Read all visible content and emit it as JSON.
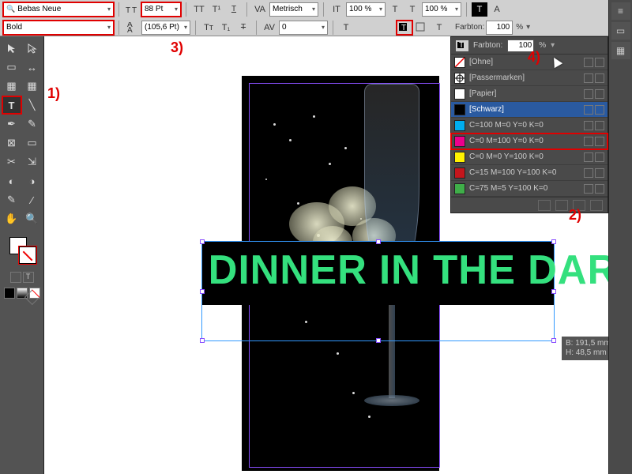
{
  "control_bar": {
    "font_family": "Bebas Neue",
    "font_style": "Bold",
    "font_size": "88 Pt",
    "leading": "(105,6 Pt)",
    "kerning_mode": "Metrisch",
    "hscale": "100 %",
    "vscale": "100 %",
    "tint_label": "Farbton:",
    "tint_value": "100",
    "tint_unit": "%"
  },
  "canvas": {
    "headline": "DINNER IN THE DARK",
    "info_w": "B: 191,5 mm",
    "info_h": "H: 48,5 mm"
  },
  "swatches": {
    "rows": [
      {
        "name": "[Ohne]",
        "color": "none",
        "sel": false
      },
      {
        "name": "[Passermarken]",
        "color": "registration",
        "sel": false
      },
      {
        "name": "[Papier]",
        "color": "#ffffff",
        "sel": false
      },
      {
        "name": "[Schwarz]",
        "color": "#000000",
        "sel": true
      },
      {
        "name": "C=100 M=0 Y=0 K=0",
        "color": "#00adef",
        "sel": false
      },
      {
        "name": "C=0 M=100 Y=0 K=0",
        "color": "#ec008c",
        "sel": false,
        "redbox": true
      },
      {
        "name": "C=0 M=0 Y=100 K=0",
        "color": "#fff200",
        "sel": false
      },
      {
        "name": "C=15 M=100 Y=100 K=0",
        "color": "#c4161c",
        "sel": false
      },
      {
        "name": "C=75 M=5 Y=100 K=0",
        "color": "#3fae49",
        "sel": false
      }
    ]
  },
  "annotations": {
    "a1": "1)",
    "a2": "2)",
    "a3": "3)",
    "a4": "4)"
  }
}
